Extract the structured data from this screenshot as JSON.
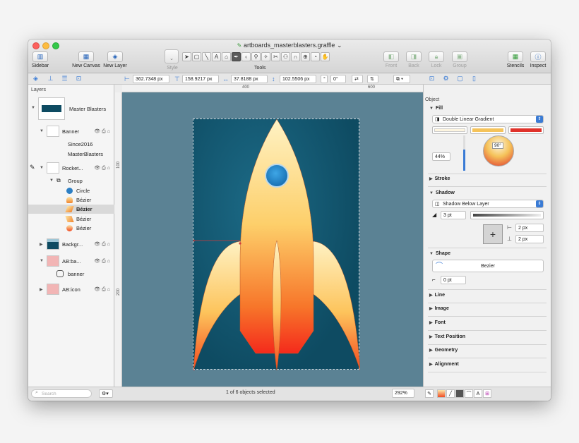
{
  "window": {
    "title": "artboards_masterblasters.graffle"
  },
  "toolbar": {
    "sidebar_label": "Sidebar",
    "new_canvas_label": "New Canvas",
    "new_layer_label": "New Layer",
    "style_label": "Style",
    "tools_label": "Tools",
    "front_label": "Front",
    "back_label": "Back",
    "lock_label": "Lock",
    "group_label": "Group",
    "stencils_label": "Stencils",
    "inspect_label": "Inspect"
  },
  "geometry": {
    "x": "362.7348 px",
    "y": "158.9217 px",
    "width": "37.8188 px",
    "height": "102.5506 px",
    "rotation": "0°"
  },
  "ruler": {
    "top_ticks": [
      "400",
      "600"
    ],
    "left_ticks": [
      "100",
      "200"
    ]
  },
  "sidebar": {
    "title": "Layers",
    "search_placeholder": "Search",
    "layers": [
      {
        "label": "Master Blasters"
      },
      {
        "label": "Banner"
      },
      {
        "label": "Since2016"
      },
      {
        "label": "MasterBlasters"
      },
      {
        "label": "Rocket..."
      },
      {
        "label": "Group"
      },
      {
        "label": "Circle"
      },
      {
        "label": "Bézier"
      },
      {
        "label": "Bézier"
      },
      {
        "label": "Bézier"
      },
      {
        "label": "Bézier"
      },
      {
        "label": "Backgr..."
      },
      {
        "label": "AB:ba..."
      },
      {
        "label": "banner"
      },
      {
        "label": "AB:icon"
      }
    ]
  },
  "status": {
    "selection": "1 of 6 objects selected",
    "zoom": "292%"
  },
  "inspector": {
    "title": "Object",
    "fill": {
      "label": "Fill",
      "type": "Double Linear Gradient",
      "opacity": "44%",
      "angle": "90°"
    },
    "stroke": {
      "label": "Stroke"
    },
    "shadow": {
      "label": "Shadow",
      "type": "Shadow Below Layer",
      "size": "3 pt",
      "offset_x": "2 px",
      "offset_y": "2 px"
    },
    "shape": {
      "label": "Shape",
      "name": "Bezier",
      "corner": "0 pt"
    },
    "line": {
      "label": "Line"
    },
    "image": {
      "label": "Image"
    },
    "font": {
      "label": "Font"
    },
    "text_position": {
      "label": "Text Position"
    },
    "geometry": {
      "label": "Geometry"
    },
    "alignment": {
      "label": "Alignment"
    }
  },
  "colors": {
    "canvas_bg": "#5b8294",
    "artboard_bg": "#0e4b62",
    "rocket_top": "#fde7a8",
    "rocket_bottom": "#f6281c",
    "accent": "#3a7bd5"
  }
}
